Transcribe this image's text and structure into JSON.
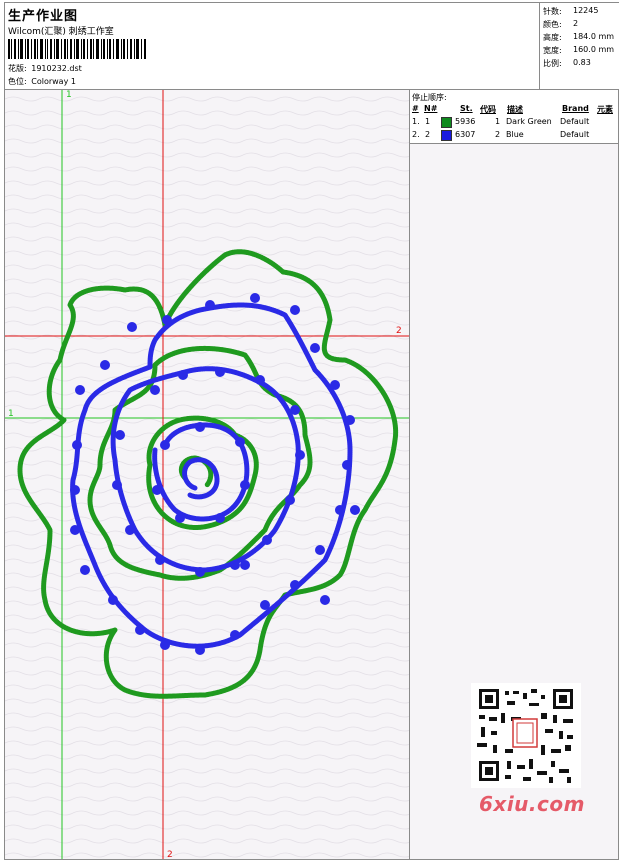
{
  "header": {
    "title": "生产作业图",
    "studio": "Wilcom(汇聚) 刺绣工作室",
    "pattern_label": "花版:",
    "pattern_value": "1910232.dst",
    "colorway_label": "色位:",
    "colorway_value": "Colorway 1"
  },
  "stats": [
    {
      "label": "针数:",
      "value": "12245"
    },
    {
      "label": "颜色:",
      "value": "2"
    },
    {
      "label": "高度:",
      "value": "184.0 mm"
    },
    {
      "label": "宽度:",
      "value": "160.0 mm"
    },
    {
      "label": "比例:",
      "value": "0.83"
    }
  ],
  "stop_sequence": {
    "title": "停止顺序:",
    "columns": [
      "#",
      "N#",
      "St.",
      "代码",
      "描述",
      "Brand",
      "元素"
    ],
    "rows": [
      {
        "num": "1.",
        "n": "1",
        "stitches": "5936",
        "code": "1",
        "description": "Dark Green",
        "brand": "Default",
        "color": "#0f8a1e"
      },
      {
        "num": "2.",
        "n": "2",
        "stitches": "6307",
        "code": "2",
        "description": "Blue",
        "brand": "Default",
        "color": "#1a1ae0"
      }
    ]
  },
  "guides": {
    "green_label": "1",
    "red_label": "2"
  },
  "colors": {
    "thread_green": "#1f9a1f",
    "thread_blue": "#2a2ae6",
    "guide_green": "#22c322",
    "guide_red": "#e01010"
  },
  "watermark": {
    "text": "6xiu.com"
  }
}
